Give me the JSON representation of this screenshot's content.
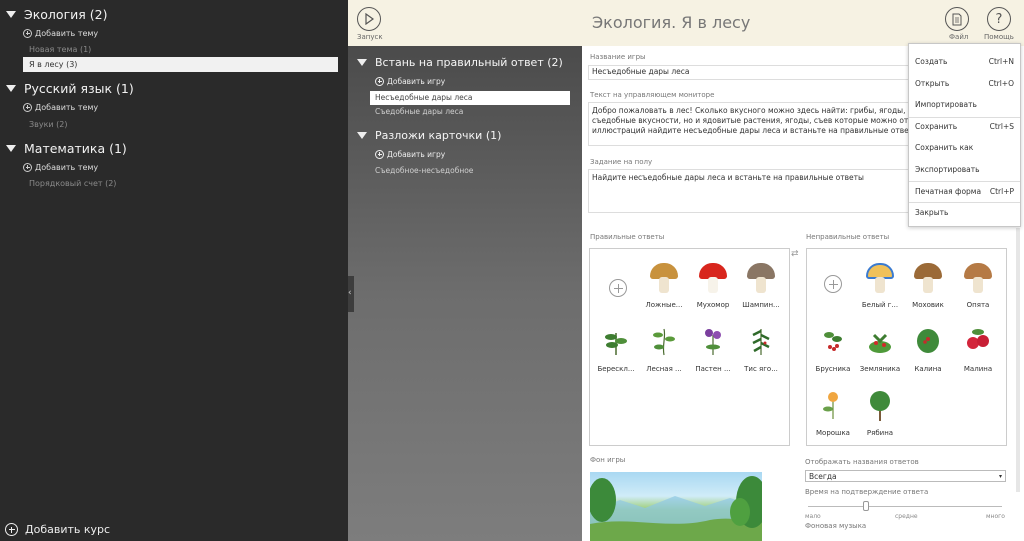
{
  "sidebar": {
    "courses": [
      {
        "title": "Экология (2)",
        "add_label": "Добавить тему",
        "topics": [
          "Новая тема (1)",
          "Я в лесу (3)"
        ]
      },
      {
        "title": "Русский язык (1)",
        "add_label": "Добавить тему",
        "topics": [
          "Звуки (2)"
        ]
      },
      {
        "title": "Математика (1)",
        "add_label": "Добавить тему",
        "topics": [
          "Порядковый счет (2)"
        ]
      }
    ],
    "selected_topic": "Я в лесу (3)",
    "add_course_label": "Добавить курс"
  },
  "topbar": {
    "run_label": "Запуск",
    "title": "Экология. Я в лесу",
    "file_label": "Файл",
    "help_label": "Помощь",
    "help_glyph": "?"
  },
  "games": [
    {
      "title": "Встань на правильный ответ (2)",
      "add_label": "Добавить игру",
      "items": [
        "Несъедобные дары леса",
        "Съедобные дары леса"
      ]
    },
    {
      "title": "Разложи карточки (1)",
      "add_label": "Добавить игру",
      "items": [
        "Съедобное-несъедобное"
      ]
    }
  ],
  "content": {
    "game_name_label": "Название игры",
    "game_name_value": "Несъедобные дары леса",
    "monitor_text_label": "Текст на управляющем мониторе",
    "monitor_text_value": "Добро пожаловать в лес! Сколько вкусного можно здесь найти: грибы, ягоды, травы! Однако не только съедобные вкусности, но и ядовитые растения, ягоды, съев которые можно отравиться. Среди иллюстраций найдите несъедобные дары леса и встаньте на правильные ответы.",
    "floor_task_label": "Задание на полу",
    "floor_task_value": "Найдите несъедобные дары леса и встаньте на правильные ответы",
    "correct_label": "Правильные ответы",
    "wrong_label": "Неправильные ответы",
    "correct_answers": [
      "Ложные...",
      "Мухомор",
      "Шампин...",
      "Берескл...",
      "Лесная ...",
      "Пастен ...",
      "Тис яго..."
    ],
    "wrong_answers": [
      "Белый г...",
      "Моховик",
      "Опята",
      "Брусника",
      "Земляника",
      "Калина",
      "Малина",
      "Морошка",
      "Рябина"
    ],
    "background_label": "Фон игры",
    "show_names_label": "Отображать названия ответов",
    "show_names_value": "Всегда",
    "confirm_time_label": "Время на подтверждение ответа",
    "confirm_time_level": 0.3,
    "scale_min": "мало",
    "scale_mid": "средне",
    "scale_max": "много",
    "music_label": "Фоновая музыка"
  },
  "file_menu": {
    "items": [
      {
        "label": "Создать",
        "shortcut": "Ctrl+N"
      },
      {
        "label": "Открыть",
        "shortcut": "Ctrl+O"
      },
      {
        "label": "Импортировать",
        "shortcut": ""
      },
      {
        "label": "Сохранить",
        "shortcut": "Ctrl+S"
      },
      {
        "label": "Сохранить как",
        "shortcut": ""
      },
      {
        "label": "Экспортировать",
        "shortcut": ""
      },
      {
        "label": "Печатная форма",
        "shortcut": "Ctrl+P"
      },
      {
        "label": "Закрыть",
        "shortcut": ""
      }
    ]
  },
  "colors": {
    "sidebar_bg": "#2a2a2a",
    "topbar_bg": "#f6f2e3",
    "selected_bg": "#f1f1f1"
  }
}
